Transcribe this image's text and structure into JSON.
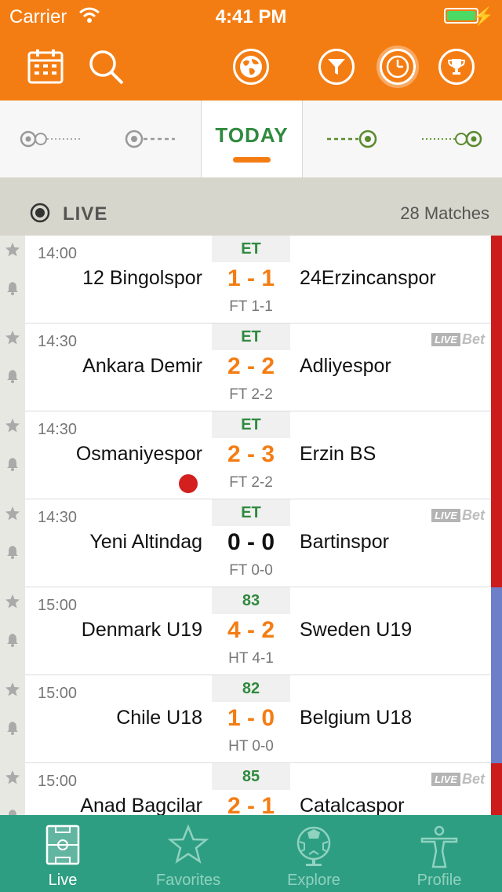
{
  "status_bar": {
    "carrier": "Carrier",
    "time": "4:41 PM"
  },
  "date_nav": {
    "today_label": "TODAY"
  },
  "live_header": {
    "label": "LIVE",
    "count": "28 Matches"
  },
  "live_bet": {
    "part_a": "LIVE",
    "part_b": "Bet"
  },
  "matches": [
    {
      "time": "14:00",
      "home": "12 Bingolspor",
      "score": "1 - 1",
      "away": "24Erzincanspor",
      "status": "ET",
      "sub": "FT 1-1",
      "bar_color": "#cc1b1b"
    },
    {
      "time": "14:30",
      "home": "Ankara Demir",
      "score": "2 - 2",
      "away": "Adliyespor",
      "status": "ET",
      "sub": "FT 2-2",
      "bar_color": "#cc1b1b"
    },
    {
      "time": "14:30",
      "home": "Osmaniyespor",
      "score": "2 - 3",
      "away": "Erzin BS",
      "status": "ET",
      "sub": "FT 2-2",
      "bar_color": "#cc1b1b"
    },
    {
      "time": "14:30",
      "home": "Yeni Altindag",
      "score": "0 - 0",
      "away": "Bartinspor",
      "status": "ET",
      "sub": "FT 0-0",
      "bar_color": "#cc1b1b"
    },
    {
      "time": "15:00",
      "home": "Denmark U19",
      "score": "4 - 2",
      "away": "Sweden U19",
      "status": "83",
      "sub": "HT 4-1",
      "bar_color": "#6c7fc8"
    },
    {
      "time": "15:00",
      "home": "Chile U18",
      "score": "1 - 0",
      "away": "Belgium U18",
      "status": "82",
      "sub": "HT 0-0",
      "bar_color": "#6c7fc8"
    },
    {
      "time": "15:00",
      "home": "Anad Bagcilar",
      "score": "2 - 1",
      "away": "Catalcaspor",
      "status": "85",
      "sub": "",
      "bar_color": "#cc1b1b"
    }
  ],
  "tabs": [
    {
      "label": "Live"
    },
    {
      "label": "Favorites"
    },
    {
      "label": "Explore"
    },
    {
      "label": "Profile"
    }
  ],
  "colors": {
    "brand_orange": "#f47d13",
    "live_green": "#2f8a3e",
    "tab_teal": "#2e9e82"
  }
}
